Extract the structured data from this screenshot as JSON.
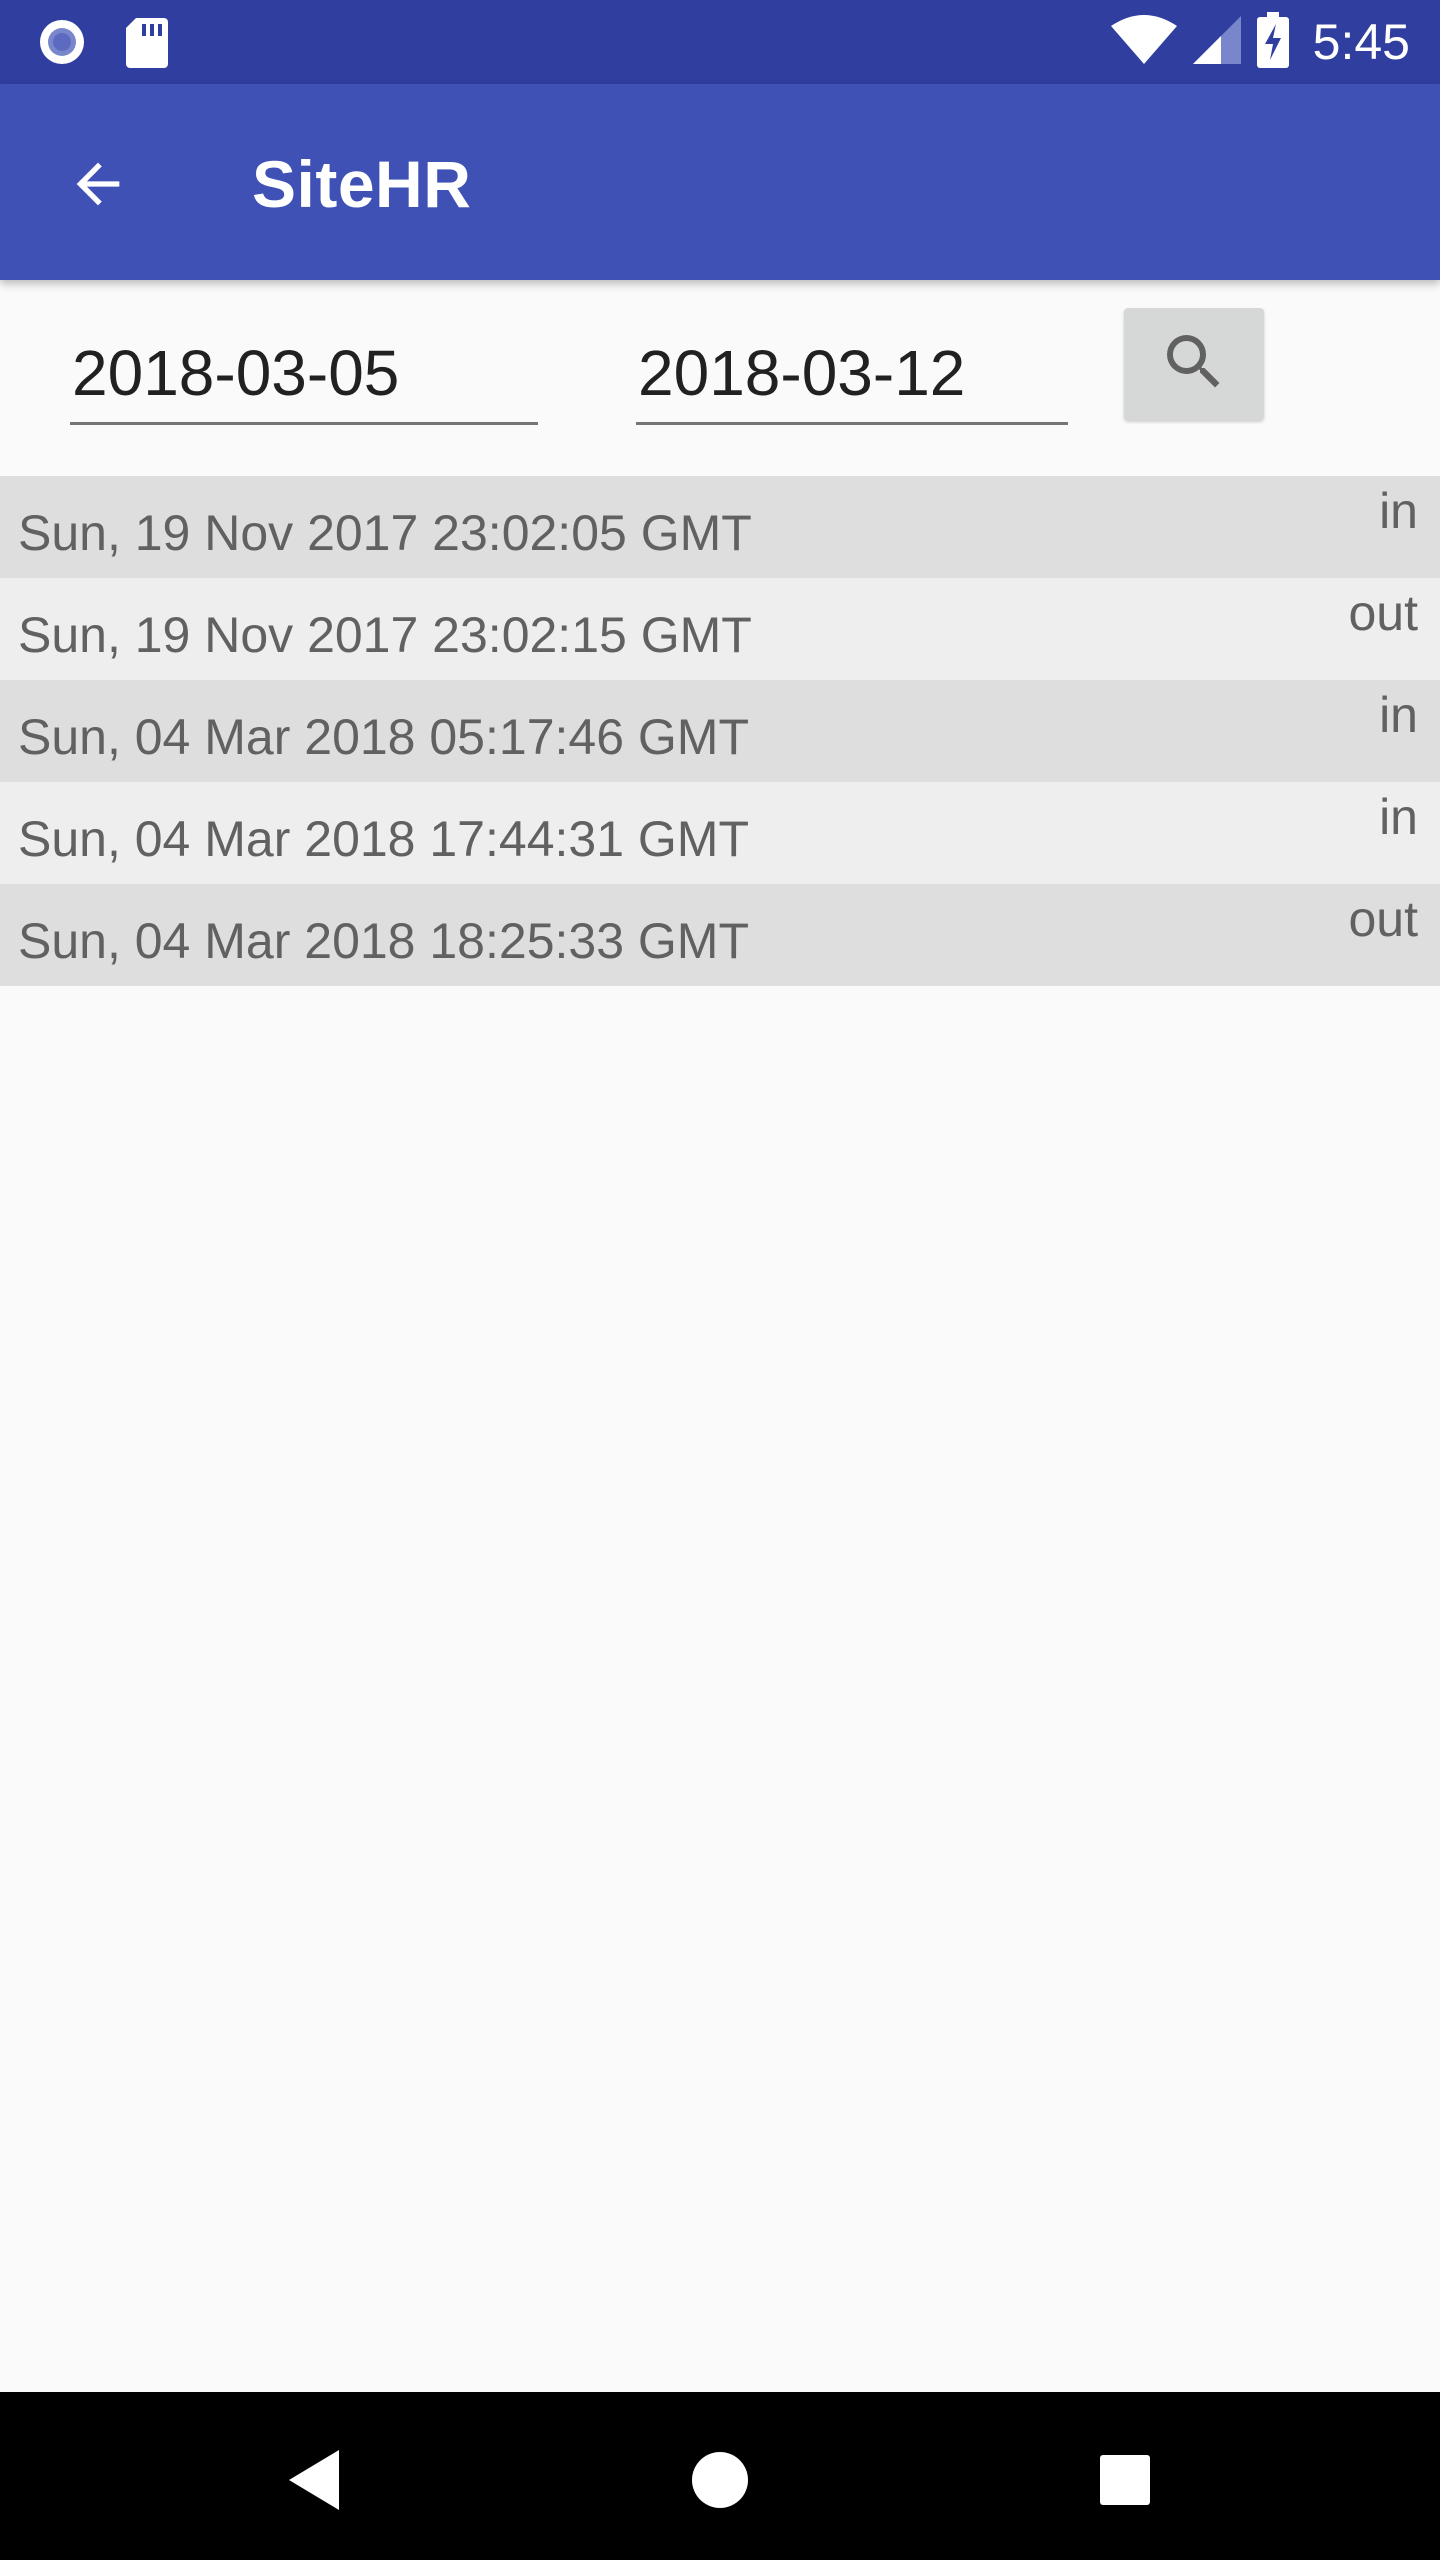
{
  "status_bar": {
    "time": "5:45",
    "icons": [
      "notification-dot-icon",
      "sd-card-icon",
      "wifi-icon",
      "signal-icon",
      "battery-charging-icon"
    ]
  },
  "app_bar": {
    "title": "SiteHR",
    "back_icon": "arrow-back-icon"
  },
  "filters": {
    "start_date": "2018-03-05",
    "end_date": "2018-03-12",
    "search_icon": "search-icon"
  },
  "log_entries": [
    {
      "timestamp": "Sun, 19 Nov 2017 23:02:05 GMT",
      "type": "in"
    },
    {
      "timestamp": "Sun, 19 Nov 2017 23:02:15 GMT",
      "type": "out"
    },
    {
      "timestamp": "Sun, 04 Mar 2018 05:17:46 GMT",
      "type": "in"
    },
    {
      "timestamp": "Sun, 04 Mar 2018 17:44:31 GMT",
      "type": "in"
    },
    {
      "timestamp": "Sun, 04 Mar 2018 18:25:33 GMT",
      "type": "out"
    }
  ],
  "nav_bar": {
    "icons": [
      "nav-back-icon",
      "nav-home-icon",
      "nav-recents-icon"
    ]
  },
  "colors": {
    "status_bar": "#303f9f",
    "app_bar": "#3f51b5",
    "row_dark": "#dedede",
    "row_light": "#eeeeee"
  }
}
